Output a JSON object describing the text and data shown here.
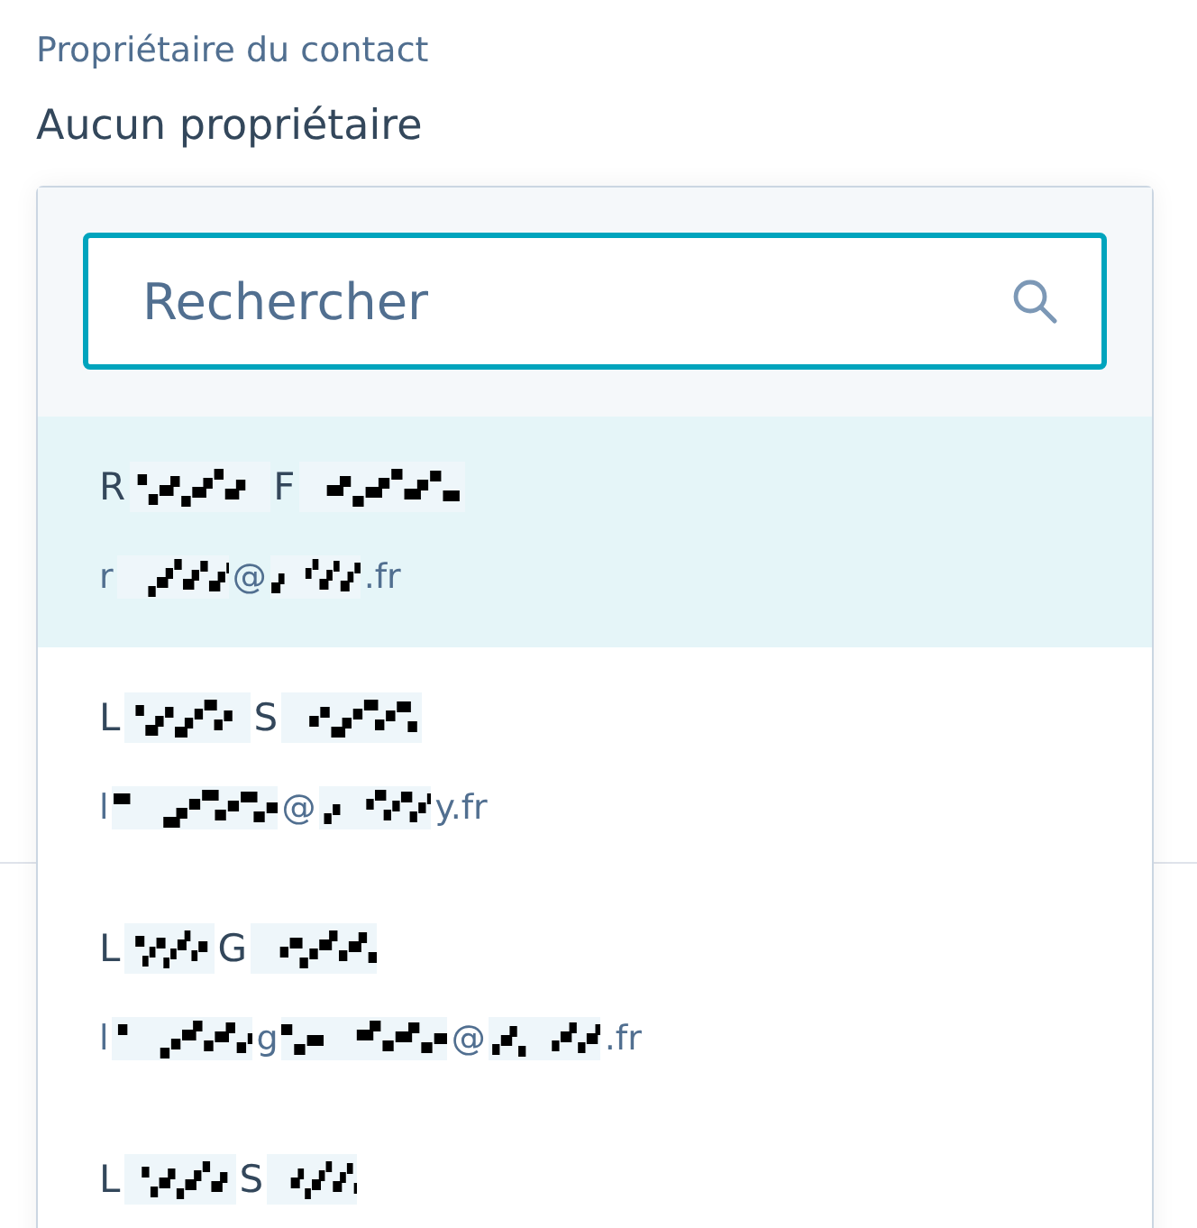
{
  "field": {
    "label": "Propriétaire du contact",
    "value": "Aucun propriétaire"
  },
  "dropdown": {
    "search": {
      "placeholder": "Rechercher"
    },
    "options": [
      {
        "selected": true,
        "name": [
          {
            "kind": "text",
            "text": "R"
          },
          {
            "kind": "redacted"
          },
          {
            "kind": "text",
            "text": "F"
          },
          {
            "kind": "redacted"
          }
        ],
        "email": [
          {
            "kind": "text",
            "text": "r"
          },
          {
            "kind": "redacted"
          },
          {
            "kind": "text",
            "text": "@"
          },
          {
            "kind": "redacted"
          },
          {
            "kind": "text",
            "text": ".fr"
          }
        ]
      },
      {
        "selected": false,
        "name": [
          {
            "kind": "text",
            "text": "L"
          },
          {
            "kind": "redacted"
          },
          {
            "kind": "text",
            "text": "S"
          },
          {
            "kind": "redacted"
          }
        ],
        "email": [
          {
            "kind": "text",
            "text": "l"
          },
          {
            "kind": "redacted"
          },
          {
            "kind": "text",
            "text": "@"
          },
          {
            "kind": "redacted"
          },
          {
            "kind": "text",
            "text": "y.fr"
          }
        ]
      },
      {
        "selected": false,
        "name": [
          {
            "kind": "text",
            "text": "L"
          },
          {
            "kind": "redacted"
          },
          {
            "kind": "text",
            "text": "G"
          },
          {
            "kind": "redacted"
          }
        ],
        "email": [
          {
            "kind": "text",
            "text": "l"
          },
          {
            "kind": "redacted"
          },
          {
            "kind": "text",
            "text": "g"
          },
          {
            "kind": "redacted"
          },
          {
            "kind": "text",
            "text": "@"
          },
          {
            "kind": "redacted"
          },
          {
            "kind": "text",
            "text": ".fr"
          }
        ]
      },
      {
        "selected": false,
        "name": [
          {
            "kind": "text",
            "text": "L"
          },
          {
            "kind": "redacted"
          },
          {
            "kind": "text",
            "text": "S"
          },
          {
            "kind": "redacted"
          }
        ]
      }
    ]
  }
}
